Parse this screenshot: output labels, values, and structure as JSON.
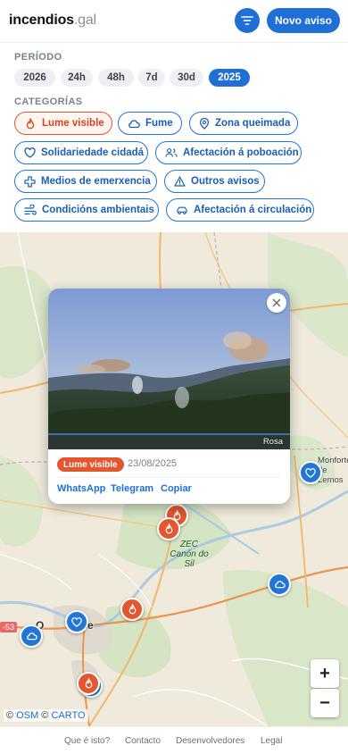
{
  "header": {
    "logo_name": "incendios",
    "logo_tld": ".gal",
    "new_report_label": "Novo aviso"
  },
  "period": {
    "label": "PERÍODO",
    "options": [
      "2026",
      "24h",
      "48h",
      "7d",
      "30d",
      "2025"
    ],
    "selected": "2025"
  },
  "categories": {
    "label": "CATEGORÍAS",
    "items": [
      {
        "label": "Lume visible",
        "icon": "flame-icon",
        "selected": true
      },
      {
        "label": "Fume",
        "icon": "cloud-icon"
      },
      {
        "label": "Zona queimada",
        "icon": "map-pin-icon"
      },
      {
        "label": "Solidariedade cidadá",
        "icon": "heart-icon"
      },
      {
        "label": "Afectación á poboación",
        "icon": "people-icon"
      },
      {
        "label": "Medios de emerxencia",
        "icon": "cross-icon"
      },
      {
        "label": "Outros avisos",
        "icon": "warning-icon"
      },
      {
        "label": "Condicións ambientais",
        "icon": "wind-icon"
      },
      {
        "label": "Afectación á circulación",
        "icon": "car-icon"
      }
    ]
  },
  "map": {
    "labels": {
      "zec": "ZEC Canón do Sil",
      "ourense_prefix": "O",
      "ourense_suffix": "ense",
      "monforte": "Monforte de Lemos",
      "road": "-53"
    },
    "zoom_in": "+",
    "zoom_out": "−",
    "attribution": {
      "sep": "©",
      "osm": "OSM",
      "carto": "CARTO"
    }
  },
  "popup": {
    "badge": "Lume visible",
    "date": "23/08/2025",
    "photo_credit": "Rosa",
    "share": [
      "WhatsApp",
      "Telegram",
      "Copiar"
    ]
  },
  "footer": {
    "links": [
      "Que é isto?",
      "Contacto",
      "Desenvolvedores",
      "Legal"
    ]
  },
  "colors": {
    "accent": "#1f6fd6",
    "fire": "#e4572e"
  }
}
